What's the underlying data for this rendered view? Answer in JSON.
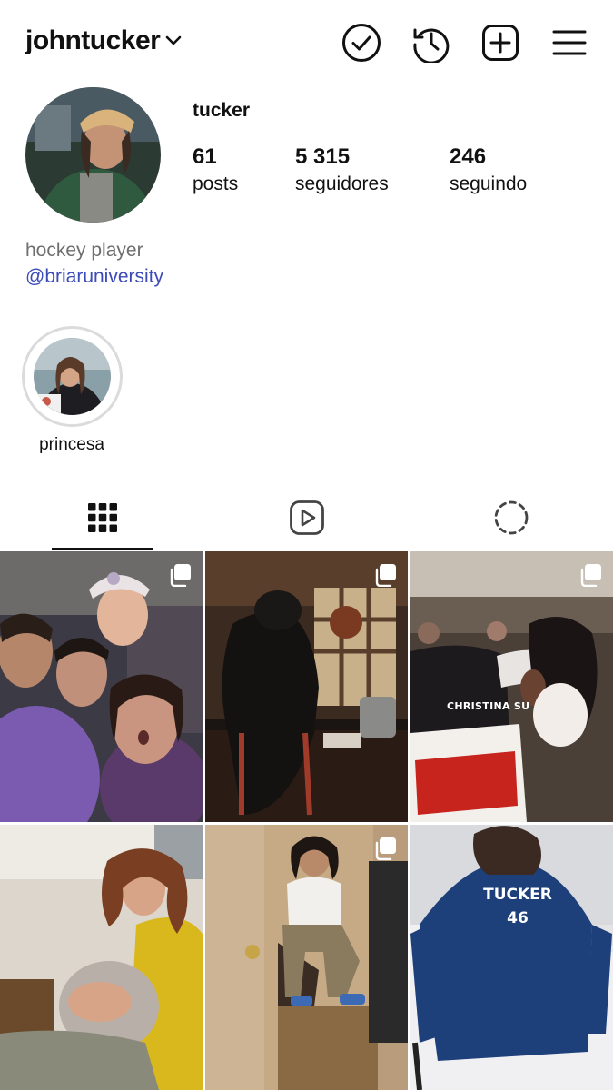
{
  "header": {
    "username": "johntucker",
    "icons": [
      "check-circle-icon",
      "history-icon",
      "add-icon",
      "menu-icon"
    ]
  },
  "profile": {
    "display_name": "tucker",
    "stats": [
      {
        "key": "posts",
        "value": "61",
        "label": "posts"
      },
      {
        "key": "followers",
        "value": "5 315",
        "label": "seguidores"
      },
      {
        "key": "following",
        "value": "246",
        "label": "seguindo"
      }
    ],
    "bio": "hockey player",
    "bio_link": "@briaruniversity"
  },
  "highlights": [
    {
      "label": "princesa"
    }
  ],
  "tabs": [
    {
      "name": "grid",
      "icon": "grid-icon",
      "active": true
    },
    {
      "name": "reels",
      "icon": "reels-icon",
      "active": false
    },
    {
      "name": "tagged",
      "icon": "loading-circle-icon",
      "active": false
    }
  ],
  "posts": [
    {
      "id": 1,
      "multi": true,
      "text": ""
    },
    {
      "id": 2,
      "multi": true,
      "text": ""
    },
    {
      "id": 3,
      "multi": true,
      "text": "CHRISTINA SU"
    },
    {
      "id": 4,
      "multi": false,
      "text": ""
    },
    {
      "id": 5,
      "multi": true,
      "text": ""
    },
    {
      "id": 6,
      "multi": false,
      "text": "TUCKER 46"
    }
  ],
  "colors": {
    "link": "#3b4bb7",
    "muted": "#6e6e6e",
    "ring": "#dbdbdb",
    "text": "#111111"
  }
}
